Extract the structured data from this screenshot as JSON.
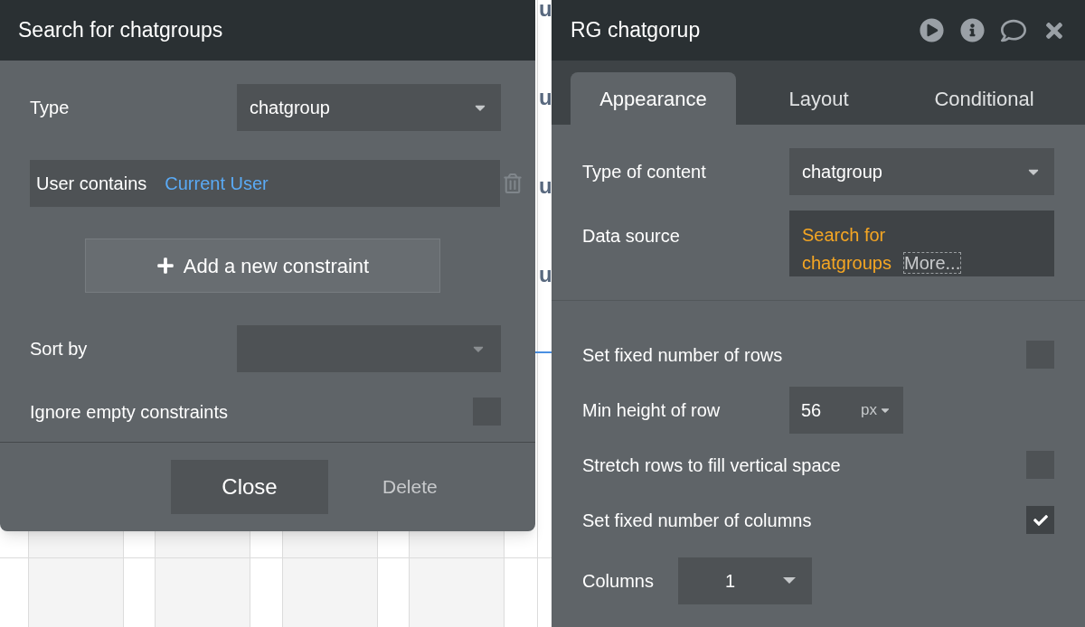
{
  "canvas": {
    "fragments": [
      "u",
      "u",
      "u",
      "u"
    ]
  },
  "search_panel": {
    "title": "Search for chatgroups",
    "type_field": {
      "label": "Type",
      "value": "chatgroup"
    },
    "constraints": [
      {
        "field": "User contains",
        "value": "Current User"
      }
    ],
    "add_button": "Add a new constraint",
    "sort_by": {
      "label": "Sort by"
    },
    "ignore_empty": {
      "label": "Ignore empty constraints",
      "checked": false
    },
    "close_button": "Close",
    "delete_button": "Delete"
  },
  "property_editor": {
    "title": "RG chatgorup",
    "tabs": [
      {
        "label": "Appearance",
        "selected": true
      },
      {
        "label": "Layout",
        "selected": false
      },
      {
        "label": "Conditional",
        "selected": false
      }
    ],
    "type_of_content": {
      "label": "Type of content",
      "value": "chatgroup"
    },
    "data_source": {
      "label": "Data source",
      "value": "Search for chatgroups",
      "more": "More..."
    },
    "settings": [
      {
        "kind": "checkbox",
        "label": "Set fixed number of rows",
        "checked": false
      },
      {
        "kind": "number",
        "label": "Min height of row",
        "value": "56",
        "unit": "px"
      },
      {
        "kind": "checkbox",
        "label": "Stretch rows to fill vertical space",
        "checked": false
      },
      {
        "kind": "checkbox",
        "label": "Set fixed number of columns",
        "checked": true
      },
      {
        "kind": "dropdown",
        "label": "Columns",
        "value": "1"
      }
    ]
  }
}
